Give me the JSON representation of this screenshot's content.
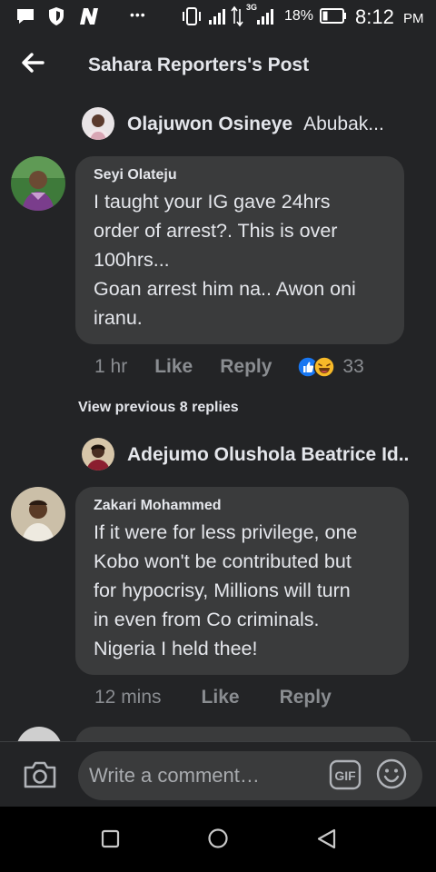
{
  "status_bar": {
    "battery": "18%",
    "network": "3G",
    "time": "8:12",
    "ampm": "PM",
    "dots": "•••"
  },
  "header": {
    "title": "Sahara Reporters's Post"
  },
  "thread1": {
    "parent_name": "Olajuwon Osineye",
    "parent_snippet": "Abubak...",
    "comment": {
      "author": "Seyi Olateju",
      "body": "I taught your IG gave 24hrs\norder of arrest?. This is over\n100hrs...\nGoan arrest him na.. Awon oni\niranu.",
      "time": "1 hr",
      "like": "Like",
      "reply": "Reply",
      "reaction_count": "33",
      "reactions": [
        "like-icon",
        "laugh-icon"
      ]
    }
  },
  "view_previous": "View previous 8 replies",
  "thread2": {
    "parent_name": "Adejumo Olushola Beatrice Id..",
    "comment": {
      "author": "Zakari Mohammed",
      "body": "If it were for less privilege, one\nKobo won't be contributed but\nfor hypocrisy, Millions will turn\nin even from Co criminals.\nNigeria I held thee!",
      "time": "12 mins",
      "like": "Like",
      "reply": "Reply"
    }
  },
  "composer": {
    "placeholder": "Write a comment…",
    "gif_label": "GIF"
  },
  "colors": {
    "background": "#232426",
    "bubble": "#3a3b3c",
    "text": "#e4e6eb",
    "muted": "#8a8d91",
    "like_blue": "#1877f2",
    "laugh_yellow": "#f7b928"
  }
}
